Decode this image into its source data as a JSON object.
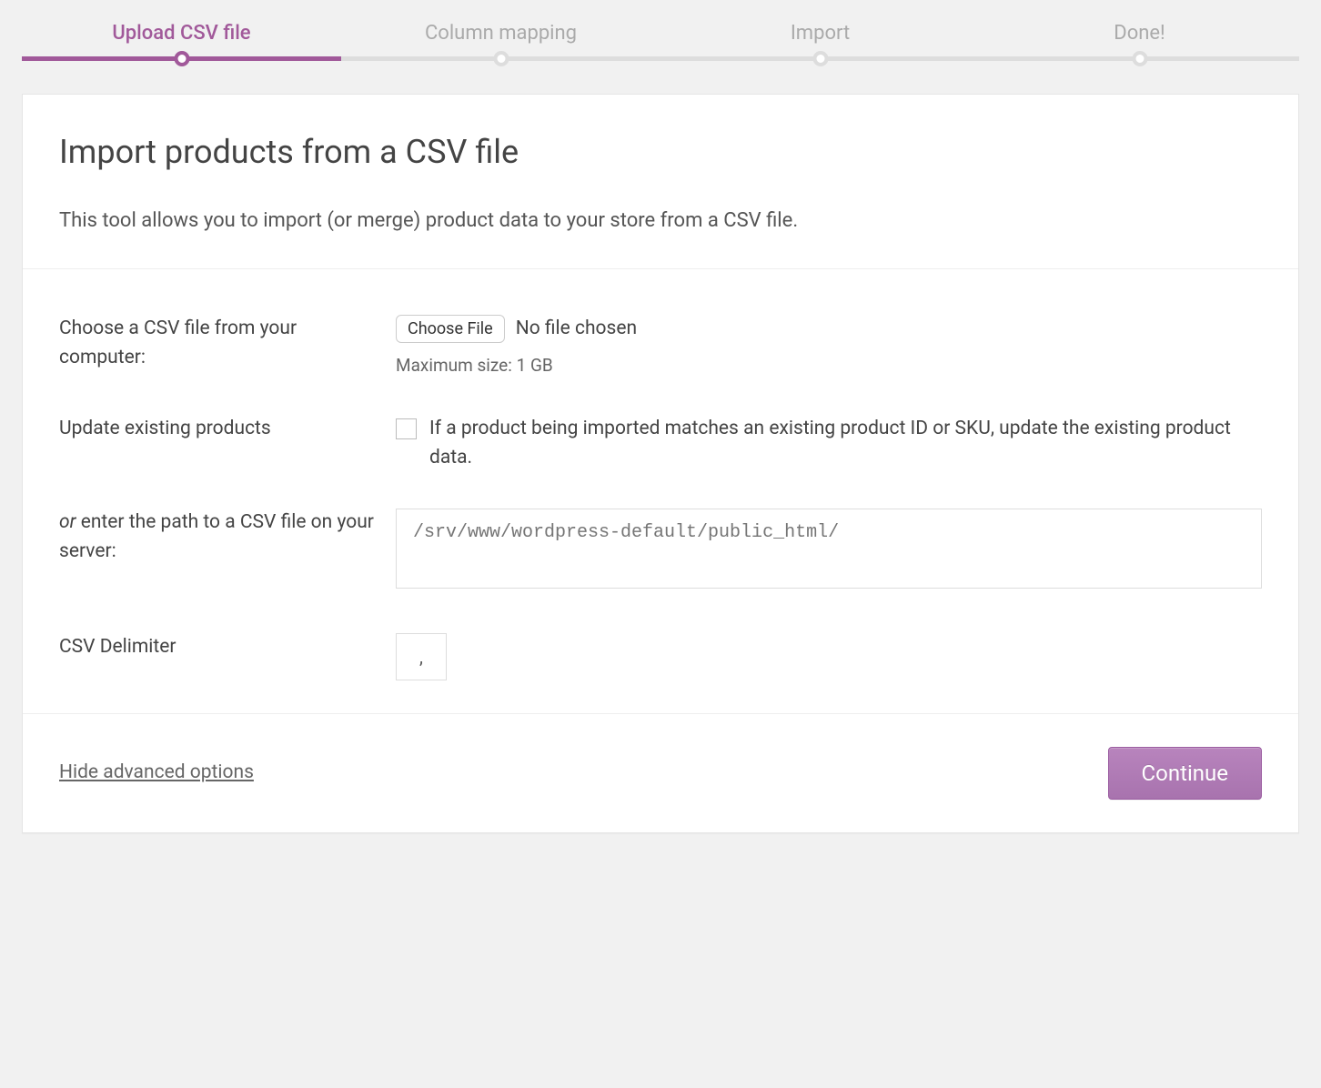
{
  "stepper": {
    "steps": [
      {
        "label": "Upload CSV file",
        "active": true
      },
      {
        "label": "Column mapping",
        "active": false
      },
      {
        "label": "Import",
        "active": false
      },
      {
        "label": "Done!",
        "active": false
      }
    ]
  },
  "header": {
    "title": "Import products from a CSV file",
    "description": "This tool allows you to import (or merge) product data to your store from a CSV file."
  },
  "form": {
    "choose_file_label": "Choose a CSV file from your computer:",
    "choose_file_button": "Choose File",
    "choose_file_status": "No file chosen",
    "max_size_hint": "Maximum size: 1 GB",
    "update_existing_label": "Update existing products",
    "update_existing_desc": "If a product being imported matches an existing product ID or SKU, update the existing product data.",
    "update_existing_checked": false,
    "server_path_prefix": "or ",
    "server_path_label": "enter the path to a CSV file on your server:",
    "server_path_placeholder": "/srv/www/wordpress-default/public_html/",
    "delimiter_label": "CSV Delimiter",
    "delimiter_value": ","
  },
  "footer": {
    "toggle_link": "Hide advanced options",
    "continue_label": "Continue"
  }
}
